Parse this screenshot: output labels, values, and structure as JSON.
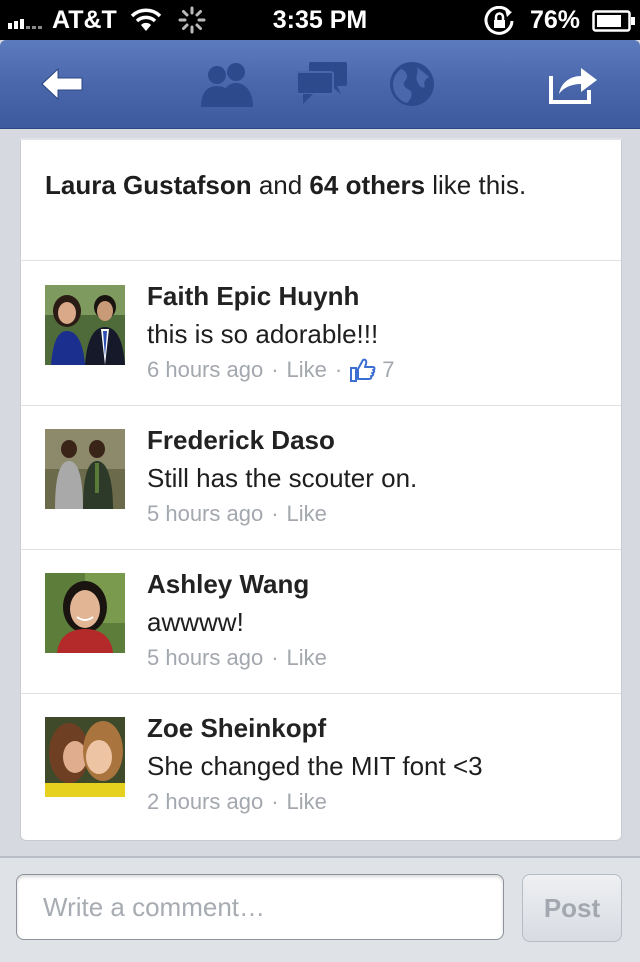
{
  "status_bar": {
    "carrier": "AT&T",
    "time": "3:35 PM",
    "battery": "76%"
  },
  "nav": {
    "icons": [
      "back-arrow-icon",
      "friends-icon",
      "messages-icon",
      "globe-icon",
      "share-icon"
    ]
  },
  "likes": {
    "name": "Laura Gustafson",
    "middle": " and ",
    "count": "64 others",
    "suffix": " like this."
  },
  "comments": [
    {
      "name": "Faith Epic Huynh",
      "text": "this is so adorable!!!",
      "time": "6 hours ago",
      "like_label": "Like",
      "like_count": "7"
    },
    {
      "name": "Frederick Daso",
      "text": "Still has the scouter on.",
      "time": "5 hours ago",
      "like_label": "Like"
    },
    {
      "name": "Ashley Wang",
      "text": "awwww!",
      "time": "5 hours ago",
      "like_label": "Like"
    },
    {
      "name": "Zoe Sheinkopf",
      "text": "She changed the MIT font <3",
      "time": "2 hours ago",
      "like_label": "Like"
    }
  ],
  "composer": {
    "placeholder": "Write a comment…",
    "post_label": "Post"
  },
  "colors": {
    "nav_blue": "#4a67ab",
    "thumb_blue": "#3b6fd1"
  }
}
